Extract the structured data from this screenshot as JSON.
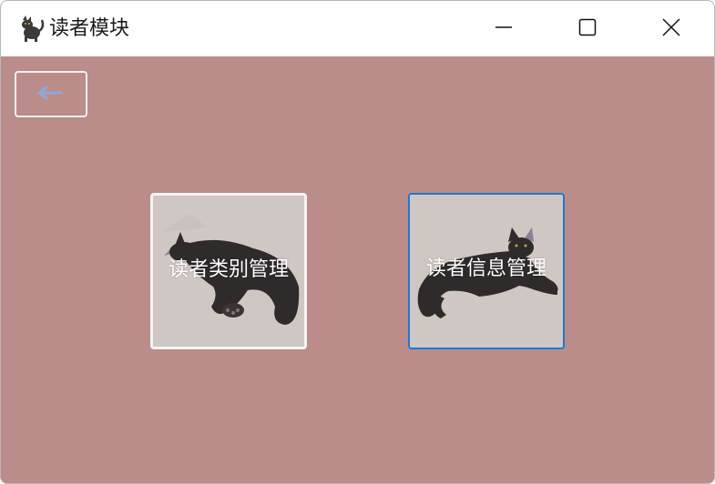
{
  "window": {
    "title": "读者模块",
    "app_icon": "cat-icon",
    "controls": {
      "minimize_icon": "minimize-icon",
      "maximize_icon": "maximize-icon",
      "close_icon": "close-icon"
    }
  },
  "toolbar": {
    "back_icon": "back-arrow-icon"
  },
  "modules": [
    {
      "label": "读者类别管理",
      "icon": "cat-icon",
      "focused": false
    },
    {
      "label": "读者信息管理",
      "icon": "cat-icon",
      "focused": true
    }
  ],
  "colors": {
    "content_background": "#ba8c8a",
    "titlebar_background": "#ffffff",
    "focus_border": "#1e78d4",
    "back_arrow": "#8fa8d8",
    "button_label": "#ffffff"
  }
}
